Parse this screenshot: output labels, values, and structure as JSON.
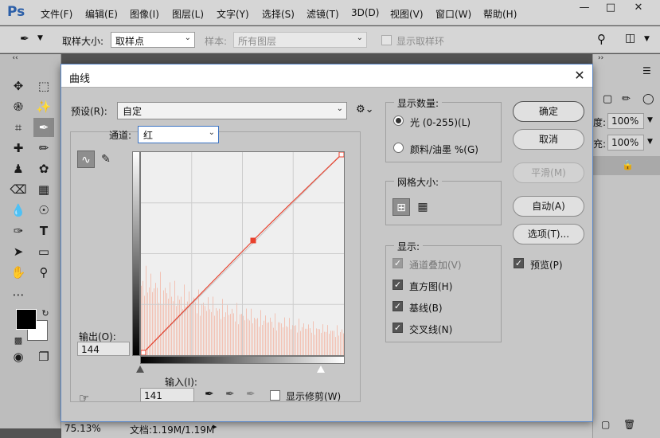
{
  "app": {
    "logo": "Ps",
    "menu": [
      "文件(F)",
      "编辑(E)",
      "图像(I)",
      "图层(L)",
      "文字(Y)",
      "选择(S)",
      "滤镜(T)",
      "3D(D)",
      "视图(V)",
      "窗口(W)",
      "帮助(H)"
    ],
    "window_controls": [
      "minimize-icon",
      "maximize-icon",
      "close-icon"
    ]
  },
  "options_bar": {
    "sample_size_label": "取样大小:",
    "sample_size_value": "取样点",
    "sample_label": "样本:",
    "sample_value": "所有图层",
    "show_ring_label": "显示取样环"
  },
  "status": {
    "zoom": "75.13%",
    "doc": "文档:1.19M/1.19M"
  },
  "right_panel": {
    "opacity_label": "度:",
    "opacity_value": "100%",
    "fill_label": "充:",
    "fill_value": "100%"
  },
  "dialog": {
    "title": "曲线",
    "preset_label": "预设(R):",
    "preset_value": "自定",
    "channel_label": "通道:",
    "channel_value": "红",
    "output_label": "输出(O):",
    "output_value": "144",
    "input_label": "输入(I):",
    "input_value": "141",
    "show_clipping_label": "显示修剪(W)",
    "display_amount": {
      "title": "显示数量:",
      "light_label": "光 (0-255)(L)",
      "pigment_label": "颜料/油墨 %(G)",
      "selected": "light"
    },
    "grid_size": {
      "title": "网格大小:"
    },
    "display": {
      "title": "显示:",
      "channel_overlay": "通道叠加(V)",
      "histogram": "直方图(H)",
      "baseline": "基线(B)",
      "intersection": "交叉线(N)"
    },
    "buttons": {
      "ok": "确定",
      "cancel": "取消",
      "smooth": "平滑(M)",
      "auto": "自动(A)",
      "options": "选项(T)..."
    },
    "preview_label": "预览(P)",
    "curve": {
      "points": [
        [
          0,
          0
        ],
        [
          141,
          144
        ],
        [
          255,
          255
        ]
      ],
      "input_range": [
        0,
        255
      ],
      "output_range": [
        0,
        255
      ],
      "color": "#e8412d"
    }
  }
}
